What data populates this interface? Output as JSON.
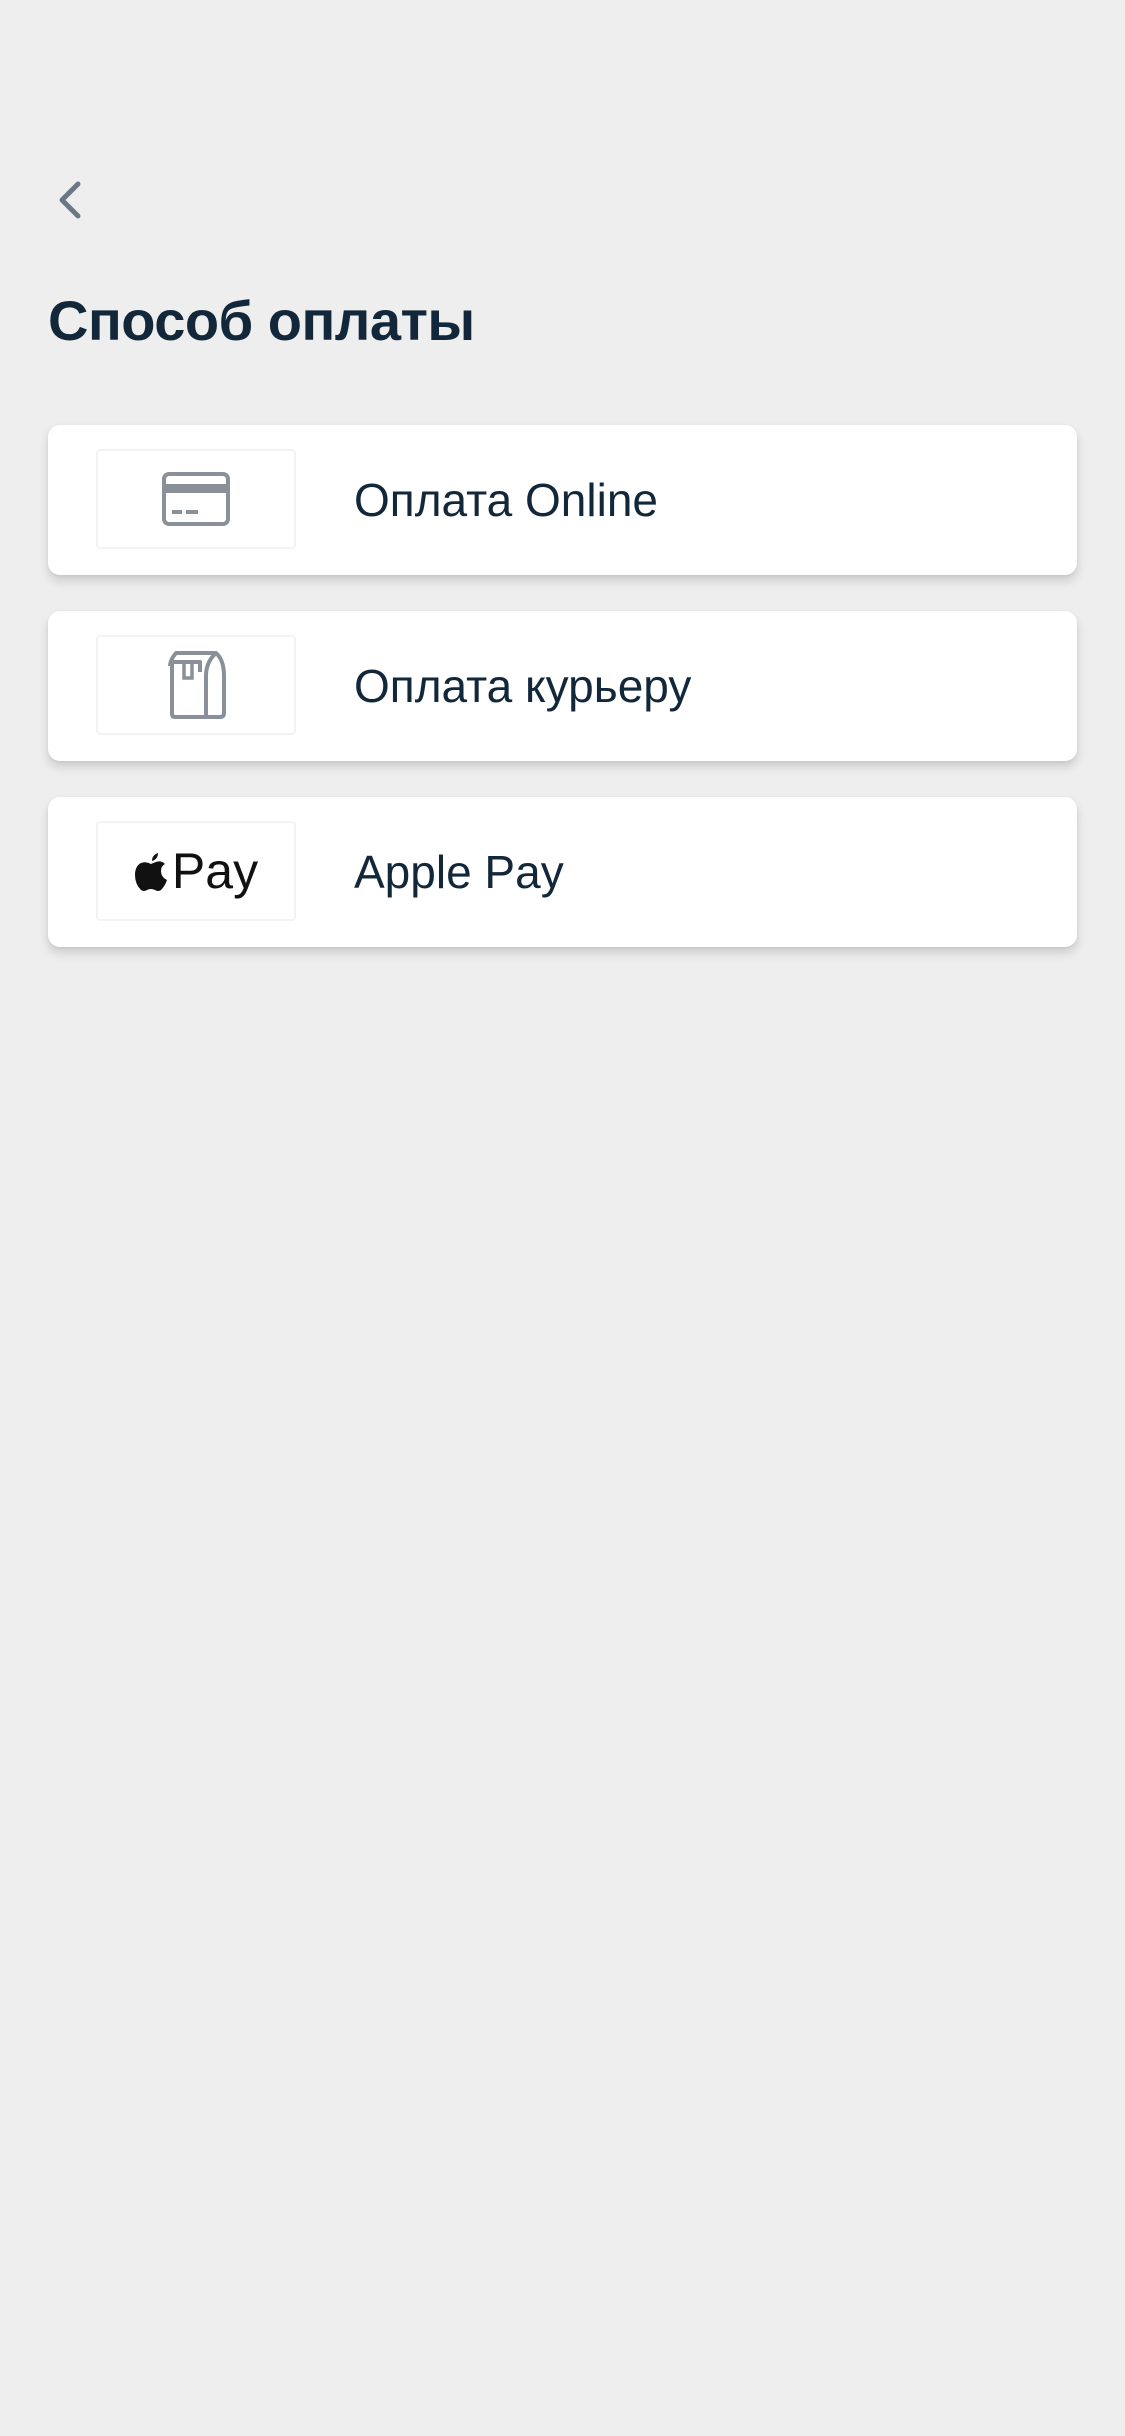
{
  "header": {
    "back_icon": "chevron-left-icon",
    "title": "Способ оплаты"
  },
  "payment_methods": [
    {
      "icon": "credit-card-icon",
      "label": "Оплата Online"
    },
    {
      "icon": "courier-bag-icon",
      "label": "Оплата курьеру"
    },
    {
      "icon": "apple-pay-logo",
      "logo_text": "Pay",
      "label": "Apple Pay"
    }
  ],
  "colors": {
    "background": "#eeeeee",
    "card": "#ffffff",
    "text": "#12283a",
    "icon": "#8a9099",
    "back_icon": "#6b7785"
  }
}
